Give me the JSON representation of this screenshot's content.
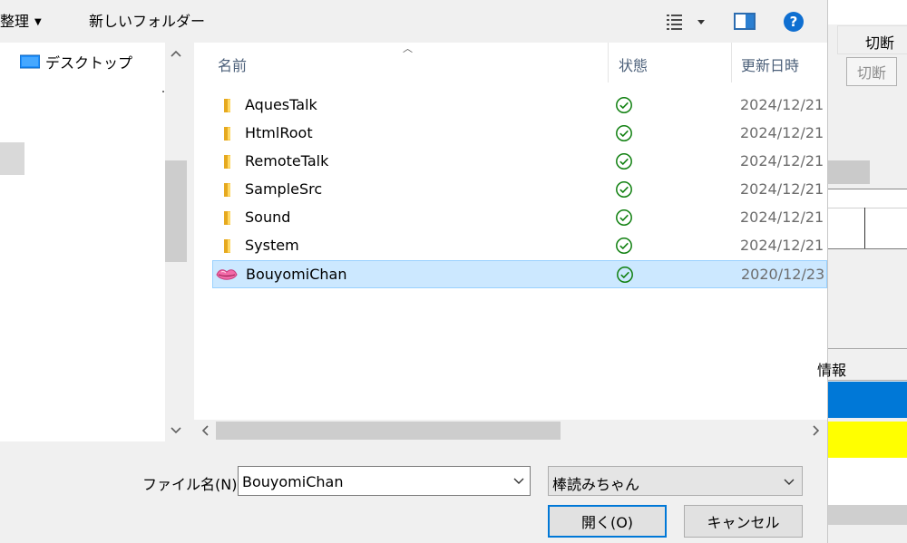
{
  "toolbar": {
    "organize_label": "整理",
    "new_folder_label": "新しいフォルダー"
  },
  "tree": {
    "items": [
      {
        "label": "デスクトップ"
      }
    ]
  },
  "columns": {
    "name": "名前",
    "status": "状態",
    "modified": "更新日時"
  },
  "files": [
    {
      "name": "AquesTalk",
      "icon": "folder-icon",
      "status": "synced",
      "date": "2024/12/21"
    },
    {
      "name": "HtmlRoot",
      "icon": "folder-icon",
      "status": "synced",
      "date": "2024/12/21"
    },
    {
      "name": "RemoteTalk",
      "icon": "folder-icon",
      "status": "synced",
      "date": "2024/12/21"
    },
    {
      "name": "SampleSrc",
      "icon": "folder-icon",
      "status": "synced",
      "date": "2024/12/21"
    },
    {
      "name": "Sound",
      "icon": "folder-icon",
      "status": "synced",
      "date": "2024/12/21"
    },
    {
      "name": "System",
      "icon": "folder-icon",
      "status": "synced",
      "date": "2024/12/21"
    },
    {
      "name": "BouyomiChan",
      "icon": "lips-icon",
      "status": "synced",
      "date": "2020/12/23",
      "selected": true
    }
  ],
  "filename": {
    "label": "ファイル名(N):",
    "value": "BouyomiChan"
  },
  "filetype": {
    "selected": "棒読みちゃん"
  },
  "buttons": {
    "open": "開く(O)",
    "cancel": "キャンセル"
  },
  "background_app": {
    "cut_label": "切断",
    "cut_label_disabled": "切断",
    "info_label": "情報"
  },
  "colors": {
    "selection": "#cce8ff",
    "accent": "#0078d7",
    "status_green": "#108010",
    "yellow": "#ffff00"
  }
}
